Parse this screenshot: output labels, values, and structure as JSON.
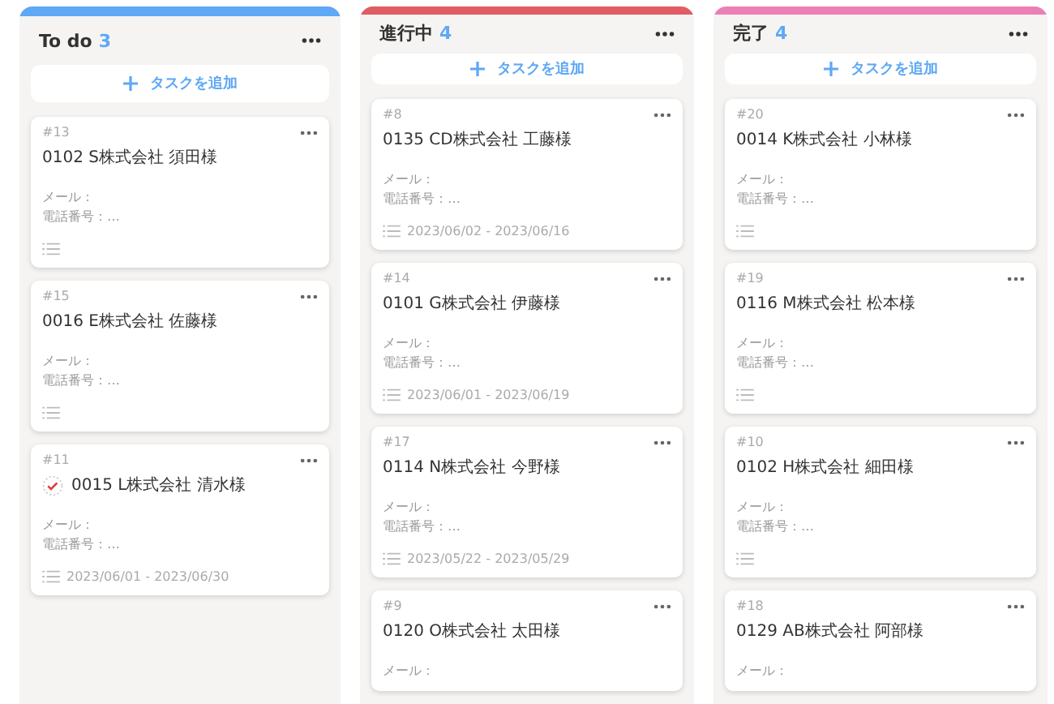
{
  "columns": [
    {
      "title": "To do",
      "count": "3",
      "color": "#5fa8f5",
      "add_label": "タスクを追加",
      "cards": [
        {
          "number": "#13",
          "title": "0102 S株式会社 須田様",
          "mail": "メール：",
          "phone": "電話番号：…"
        },
        {
          "number": "#15",
          "title": "0016 E株式会社 佐藤様",
          "mail": "メール：",
          "phone": "電話番号：…"
        },
        {
          "number": "#11",
          "title": "0015 L株式会社 清水様",
          "checked": true,
          "mail": "メール：",
          "phone": "電話番号：…",
          "dates": "2023/06/01 - 2023/06/30"
        }
      ]
    },
    {
      "title": "進行中",
      "count": "4",
      "color": "#e25c63",
      "add_label": "タスクを追加",
      "cards": [
        {
          "number": "#8",
          "title": "0135 CD株式会社 工藤様",
          "mail": "メール：",
          "phone": "電話番号：…",
          "dates": "2023/06/02 - 2023/06/16"
        },
        {
          "number": "#14",
          "title": "0101 G株式会社 伊藤様",
          "mail": "メール：",
          "phone": "電話番号：…",
          "dates": "2023/06/01 - 2023/06/19"
        },
        {
          "number": "#17",
          "title": "0114 N株式会社 今野様",
          "mail": "メール：",
          "phone": "電話番号：…",
          "dates": "2023/05/22 - 2023/05/29"
        },
        {
          "number": "#9",
          "title": "0120 O株式会社 太田様",
          "mail": "メール："
        }
      ]
    },
    {
      "title": "完了",
      "count": "4",
      "color": "#ec7fb3",
      "add_label": "タスクを追加",
      "cards": [
        {
          "number": "#20",
          "title": "0014 K株式会社 小林様",
          "mail": "メール：",
          "phone": "電話番号：…"
        },
        {
          "number": "#19",
          "title": "0116 M株式会社 松本様",
          "mail": "メール：",
          "phone": "電話番号：…"
        },
        {
          "number": "#10",
          "title": "0102 H株式会社 細田様",
          "mail": "メール：",
          "phone": "電話番号：…"
        },
        {
          "number": "#18",
          "title": "0129 AB株式会社 阿部様",
          "mail": "メール："
        }
      ]
    }
  ]
}
